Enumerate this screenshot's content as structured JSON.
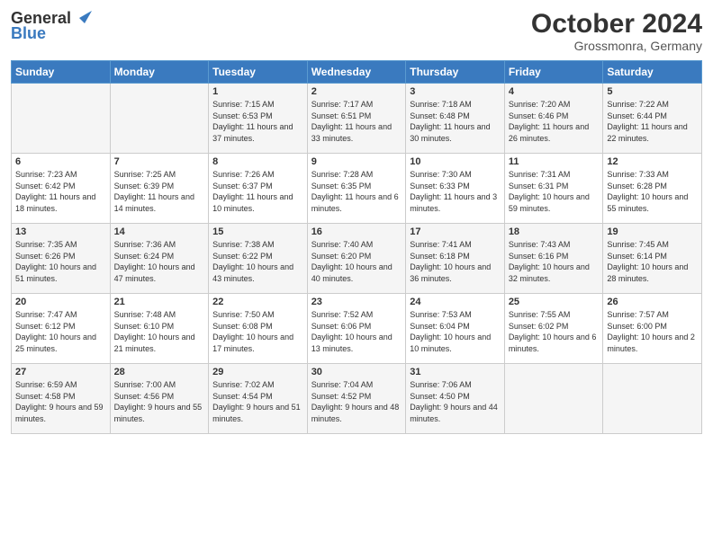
{
  "header": {
    "logo_line1": "General",
    "logo_line2": "Blue",
    "month_title": "October 2024",
    "location": "Grossmonra, Germany"
  },
  "weekdays": [
    "Sunday",
    "Monday",
    "Tuesday",
    "Wednesday",
    "Thursday",
    "Friday",
    "Saturday"
  ],
  "weeks": [
    [
      {
        "day": "",
        "sunrise": "",
        "sunset": "",
        "daylight": ""
      },
      {
        "day": "",
        "sunrise": "",
        "sunset": "",
        "daylight": ""
      },
      {
        "day": "1",
        "sunrise": "Sunrise: 7:15 AM",
        "sunset": "Sunset: 6:53 PM",
        "daylight": "Daylight: 11 hours and 37 minutes."
      },
      {
        "day": "2",
        "sunrise": "Sunrise: 7:17 AM",
        "sunset": "Sunset: 6:51 PM",
        "daylight": "Daylight: 11 hours and 33 minutes."
      },
      {
        "day": "3",
        "sunrise": "Sunrise: 7:18 AM",
        "sunset": "Sunset: 6:48 PM",
        "daylight": "Daylight: 11 hours and 30 minutes."
      },
      {
        "day": "4",
        "sunrise": "Sunrise: 7:20 AM",
        "sunset": "Sunset: 6:46 PM",
        "daylight": "Daylight: 11 hours and 26 minutes."
      },
      {
        "day": "5",
        "sunrise": "Sunrise: 7:22 AM",
        "sunset": "Sunset: 6:44 PM",
        "daylight": "Daylight: 11 hours and 22 minutes."
      }
    ],
    [
      {
        "day": "6",
        "sunrise": "Sunrise: 7:23 AM",
        "sunset": "Sunset: 6:42 PM",
        "daylight": "Daylight: 11 hours and 18 minutes."
      },
      {
        "day": "7",
        "sunrise": "Sunrise: 7:25 AM",
        "sunset": "Sunset: 6:39 PM",
        "daylight": "Daylight: 11 hours and 14 minutes."
      },
      {
        "day": "8",
        "sunrise": "Sunrise: 7:26 AM",
        "sunset": "Sunset: 6:37 PM",
        "daylight": "Daylight: 11 hours and 10 minutes."
      },
      {
        "day": "9",
        "sunrise": "Sunrise: 7:28 AM",
        "sunset": "Sunset: 6:35 PM",
        "daylight": "Daylight: 11 hours and 6 minutes."
      },
      {
        "day": "10",
        "sunrise": "Sunrise: 7:30 AM",
        "sunset": "Sunset: 6:33 PM",
        "daylight": "Daylight: 11 hours and 3 minutes."
      },
      {
        "day": "11",
        "sunrise": "Sunrise: 7:31 AM",
        "sunset": "Sunset: 6:31 PM",
        "daylight": "Daylight: 10 hours and 59 minutes."
      },
      {
        "day": "12",
        "sunrise": "Sunrise: 7:33 AM",
        "sunset": "Sunset: 6:28 PM",
        "daylight": "Daylight: 10 hours and 55 minutes."
      }
    ],
    [
      {
        "day": "13",
        "sunrise": "Sunrise: 7:35 AM",
        "sunset": "Sunset: 6:26 PM",
        "daylight": "Daylight: 10 hours and 51 minutes."
      },
      {
        "day": "14",
        "sunrise": "Sunrise: 7:36 AM",
        "sunset": "Sunset: 6:24 PM",
        "daylight": "Daylight: 10 hours and 47 minutes."
      },
      {
        "day": "15",
        "sunrise": "Sunrise: 7:38 AM",
        "sunset": "Sunset: 6:22 PM",
        "daylight": "Daylight: 10 hours and 43 minutes."
      },
      {
        "day": "16",
        "sunrise": "Sunrise: 7:40 AM",
        "sunset": "Sunset: 6:20 PM",
        "daylight": "Daylight: 10 hours and 40 minutes."
      },
      {
        "day": "17",
        "sunrise": "Sunrise: 7:41 AM",
        "sunset": "Sunset: 6:18 PM",
        "daylight": "Daylight: 10 hours and 36 minutes."
      },
      {
        "day": "18",
        "sunrise": "Sunrise: 7:43 AM",
        "sunset": "Sunset: 6:16 PM",
        "daylight": "Daylight: 10 hours and 32 minutes."
      },
      {
        "day": "19",
        "sunrise": "Sunrise: 7:45 AM",
        "sunset": "Sunset: 6:14 PM",
        "daylight": "Daylight: 10 hours and 28 minutes."
      }
    ],
    [
      {
        "day": "20",
        "sunrise": "Sunrise: 7:47 AM",
        "sunset": "Sunset: 6:12 PM",
        "daylight": "Daylight: 10 hours and 25 minutes."
      },
      {
        "day": "21",
        "sunrise": "Sunrise: 7:48 AM",
        "sunset": "Sunset: 6:10 PM",
        "daylight": "Daylight: 10 hours and 21 minutes."
      },
      {
        "day": "22",
        "sunrise": "Sunrise: 7:50 AM",
        "sunset": "Sunset: 6:08 PM",
        "daylight": "Daylight: 10 hours and 17 minutes."
      },
      {
        "day": "23",
        "sunrise": "Sunrise: 7:52 AM",
        "sunset": "Sunset: 6:06 PM",
        "daylight": "Daylight: 10 hours and 13 minutes."
      },
      {
        "day": "24",
        "sunrise": "Sunrise: 7:53 AM",
        "sunset": "Sunset: 6:04 PM",
        "daylight": "Daylight: 10 hours and 10 minutes."
      },
      {
        "day": "25",
        "sunrise": "Sunrise: 7:55 AM",
        "sunset": "Sunset: 6:02 PM",
        "daylight": "Daylight: 10 hours and 6 minutes."
      },
      {
        "day": "26",
        "sunrise": "Sunrise: 7:57 AM",
        "sunset": "Sunset: 6:00 PM",
        "daylight": "Daylight: 10 hours and 2 minutes."
      }
    ],
    [
      {
        "day": "27",
        "sunrise": "Sunrise: 6:59 AM",
        "sunset": "Sunset: 4:58 PM",
        "daylight": "Daylight: 9 hours and 59 minutes."
      },
      {
        "day": "28",
        "sunrise": "Sunrise: 7:00 AM",
        "sunset": "Sunset: 4:56 PM",
        "daylight": "Daylight: 9 hours and 55 minutes."
      },
      {
        "day": "29",
        "sunrise": "Sunrise: 7:02 AM",
        "sunset": "Sunset: 4:54 PM",
        "daylight": "Daylight: 9 hours and 51 minutes."
      },
      {
        "day": "30",
        "sunrise": "Sunrise: 7:04 AM",
        "sunset": "Sunset: 4:52 PM",
        "daylight": "Daylight: 9 hours and 48 minutes."
      },
      {
        "day": "31",
        "sunrise": "Sunrise: 7:06 AM",
        "sunset": "Sunset: 4:50 PM",
        "daylight": "Daylight: 9 hours and 44 minutes."
      },
      {
        "day": "",
        "sunrise": "",
        "sunset": "",
        "daylight": ""
      },
      {
        "day": "",
        "sunrise": "",
        "sunset": "",
        "daylight": ""
      }
    ]
  ]
}
